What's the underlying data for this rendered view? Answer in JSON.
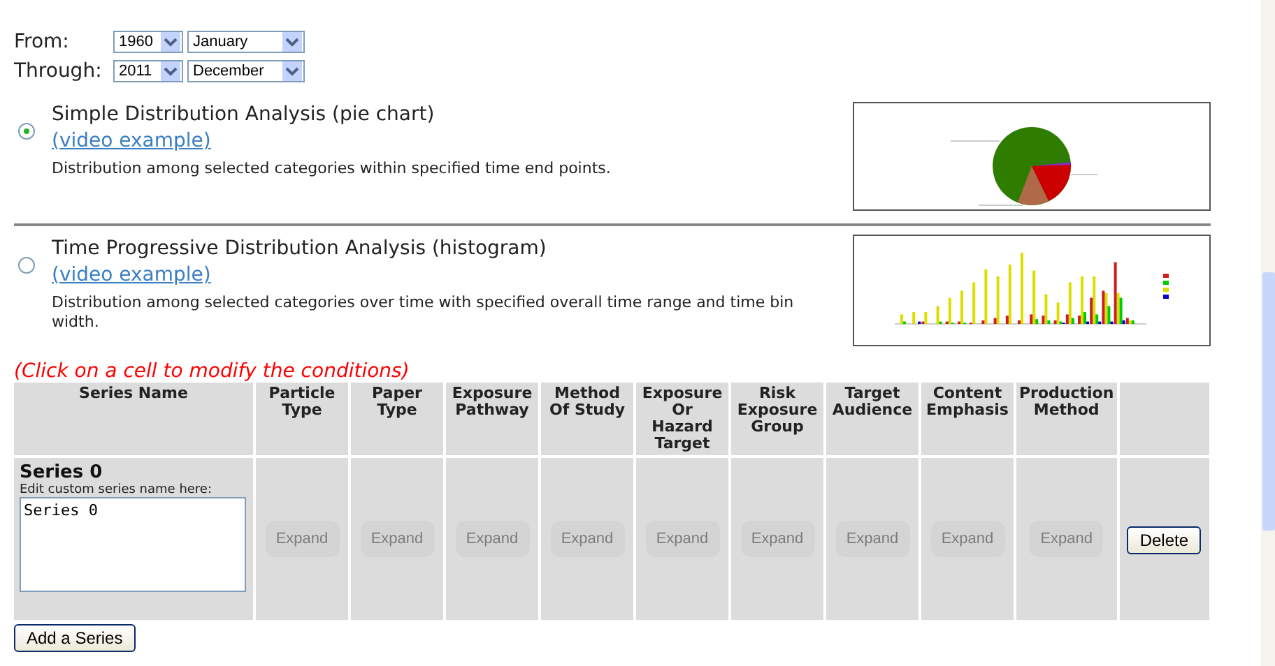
{
  "date_range": [
    {
      "label": "From:",
      "year": "1960",
      "month": "January"
    },
    {
      "label": "Through:",
      "year": "2011",
      "month": "December"
    }
  ],
  "analyses": [
    {
      "title": "Simple Distribution Analysis (pie chart)",
      "link": "(video example)",
      "description": "Distribution among selected categories within specified time end points.",
      "selected": true,
      "kind": "pie"
    },
    {
      "title": "Time Progressive Distribution Analysis (histogram)",
      "link": "(video example)",
      "description": "Distribution among selected categories over time with specified overall time range and time bin width.",
      "selected": false,
      "kind": "histogram"
    }
  ],
  "instruction": "(Click on a cell to modify the conditions)",
  "table": {
    "columns": [
      "Series Name",
      "Particle Type",
      "Paper Type",
      "Exposure Pathway",
      "Method Of Study",
      "Exposure Or Hazard Target",
      "Risk Exposure Group",
      "Target Audience",
      "Content Emphasis",
      "Production Method"
    ],
    "rows": [
      {
        "cells": [
          {
            "kind": "series",
            "name": "Series 0",
            "edit_label": "Edit custom series name here:",
            "value": "Series 0"
          },
          {
            "label": "Expand",
            "disabled": true
          },
          {
            "label": "Expand",
            "disabled": true
          },
          {
            "label": "Expand",
            "disabled": true
          },
          {
            "label": "Expand",
            "disabled": true
          },
          {
            "label": "Expand",
            "disabled": true
          },
          {
            "label": "Expand",
            "disabled": true
          },
          {
            "label": "Expand",
            "disabled": true
          },
          {
            "label": "Expand",
            "disabled": true
          },
          {
            "label": "Expand",
            "disabled": true
          },
          {
            "kind": "delete",
            "label": "Delete"
          }
        ]
      }
    ]
  },
  "add_button": "Add a Series"
}
